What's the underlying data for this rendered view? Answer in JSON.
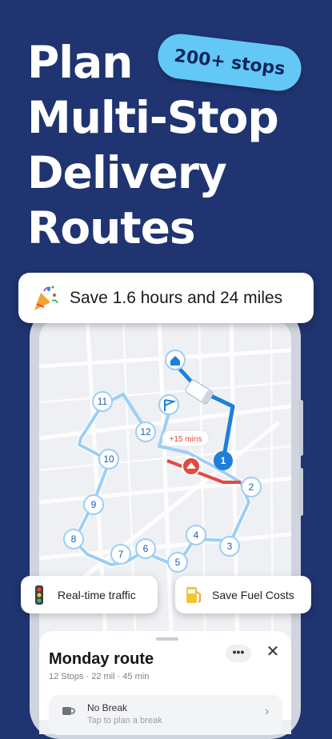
{
  "headline": {
    "line1": "Plan",
    "line2": "Multi-Stop",
    "line3": "Delivery",
    "line4": "Routes"
  },
  "badge": {
    "text": "200+ stops"
  },
  "save_banner": {
    "text": "Save 1.6 hours and 24 miles",
    "icon": "party-popper-icon"
  },
  "map": {
    "stops": [
      "1",
      "2",
      "3",
      "4",
      "5",
      "6",
      "7",
      "8",
      "9",
      "10",
      "11",
      "12"
    ],
    "traffic_delay": "+15 mins"
  },
  "feature_pills": [
    {
      "label": "Real-time traffic",
      "icon": "traffic-light-icon"
    },
    {
      "label": "Save Fuel Costs",
      "icon": "fuel-pump-icon"
    }
  ],
  "route_sheet": {
    "title": "Monday route",
    "subtitle": "12 Stops · 22 mil · 45 min",
    "more": "•••",
    "close": "✕",
    "break_title": "No Break",
    "break_hint": "Tap to plan a break"
  },
  "colors": {
    "background": "#1f3470",
    "badge": "#63c8f6",
    "route_active": "#1f7fd6",
    "route_light": "#9ccff6",
    "traffic_red": "#e5483f"
  }
}
